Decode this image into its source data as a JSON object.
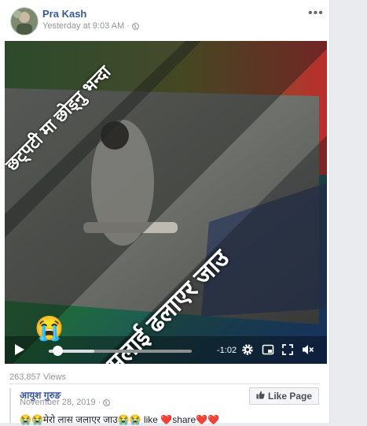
{
  "post": {
    "author": "Pra Kash",
    "timestamp": "Yesterday at 9:03 AM",
    "privacy_separator": "·",
    "privacy_icon": "globe-icon",
    "more_label": "•••"
  },
  "video": {
    "overlay_text_top": "छट्पटी मा छोड्नु भन्दा",
    "overlay_text_bottom": "मलाई ढलाएर जाउ",
    "emoji": "😭",
    "time_remaining": "-1:02",
    "progress": 0.06,
    "buffered": 0.32,
    "icons": [
      "play-icon",
      "settings-icon",
      "picture-in-picture-icon",
      "fullscreen-icon",
      "mute-icon"
    ]
  },
  "stats": {
    "views": "263,857 Views"
  },
  "shared": {
    "page_name": "आयुश गुरुङ",
    "date": "November 28, 2019",
    "separator": "·",
    "like_page_label": "Like Page",
    "caption": "😭😭मेरो लास जलाएर जाउ😭😭 like ❤️share❤️❤️"
  },
  "colors": {
    "link": "#385898",
    "meta": "#90949c",
    "background": "#e9ebee"
  }
}
